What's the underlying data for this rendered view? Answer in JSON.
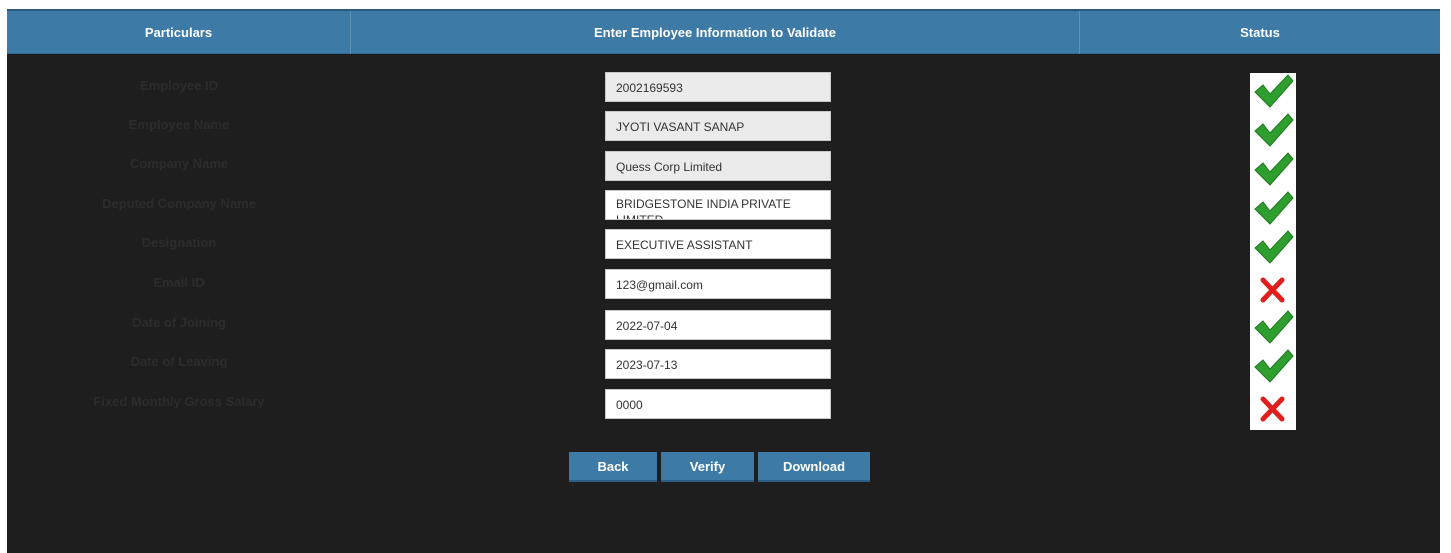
{
  "header": {
    "particulars": "Particulars",
    "enter_info": "Enter Employee Information to Validate",
    "status": "Status"
  },
  "rows": [
    {
      "label": "Employee ID",
      "value": "2002169593",
      "editable": false,
      "status": "valid"
    },
    {
      "label": "Employee Name",
      "value": "JYOTI VASANT SANAP",
      "editable": false,
      "status": "valid"
    },
    {
      "label": "Company Name",
      "value": "Quess Corp Limited",
      "editable": false,
      "status": "valid"
    },
    {
      "label": "Deputed Company Name",
      "value": "BRIDGESTONE INDIA PRIVATE LIMITED",
      "editable": true,
      "status": "valid"
    },
    {
      "label": "Designation",
      "value": "EXECUTIVE ASSISTANT",
      "editable": true,
      "status": "valid"
    },
    {
      "label": "Email ID",
      "value": "123@gmail.com",
      "editable": true,
      "status": "invalid"
    },
    {
      "label": "Date of Joining",
      "value": "2022-07-04",
      "editable": true,
      "status": "valid"
    },
    {
      "label": "Date of Leaving",
      "value": "2023-07-13",
      "editable": true,
      "status": "valid"
    },
    {
      "label": "Fixed Monthly Gross Salary",
      "value": "0000",
      "editable": true,
      "status": "invalid"
    }
  ],
  "buttons": {
    "back": "Back",
    "verify": "Verify",
    "download": "Download"
  },
  "colors": {
    "header_bg": "#3d7aa6",
    "page_bg": "#1e1e1e",
    "valid": "#2e9e2e",
    "invalid": "#e01e1e"
  },
  "icons": {
    "valid": "checkmark-icon",
    "invalid": "cross-icon"
  }
}
